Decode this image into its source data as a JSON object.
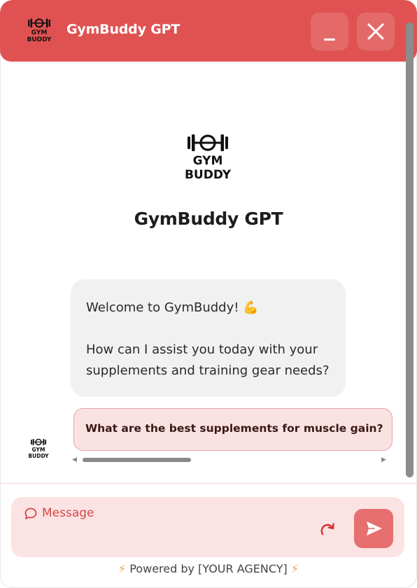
{
  "header": {
    "title": "GymBuddy GPT",
    "minimize_icon": "minimize-icon",
    "close_icon": "close-icon"
  },
  "brand": {
    "logo_icon": "dumbbell-icon",
    "logo_line1": "GYM",
    "logo_line2": "BUDDY",
    "title": "GymBuddy GPT"
  },
  "messages": {
    "bot": {
      "line1": "Welcome to GymBuddy! 💪",
      "line2": "How can I assist you today with your",
      "line3": "supplements and training gear needs?"
    },
    "user": {
      "text": "What are the best supplements for muscle gain?"
    }
  },
  "composer": {
    "placeholder": "Message",
    "message_icon": "chat-bubble-icon",
    "refresh_icon": "refresh-icon",
    "send_icon": "send-icon"
  },
  "footer": {
    "bolt": "⚡",
    "powered_text": "Powered by [YOUR AGENCY]"
  },
  "colors": {
    "accent": "#e05252",
    "composer_bg": "#fbe3e3",
    "bot_bubble_bg": "#f1f1f1",
    "user_bubble_bg": "#fbe2e2",
    "send_button": "#e86f6f"
  }
}
